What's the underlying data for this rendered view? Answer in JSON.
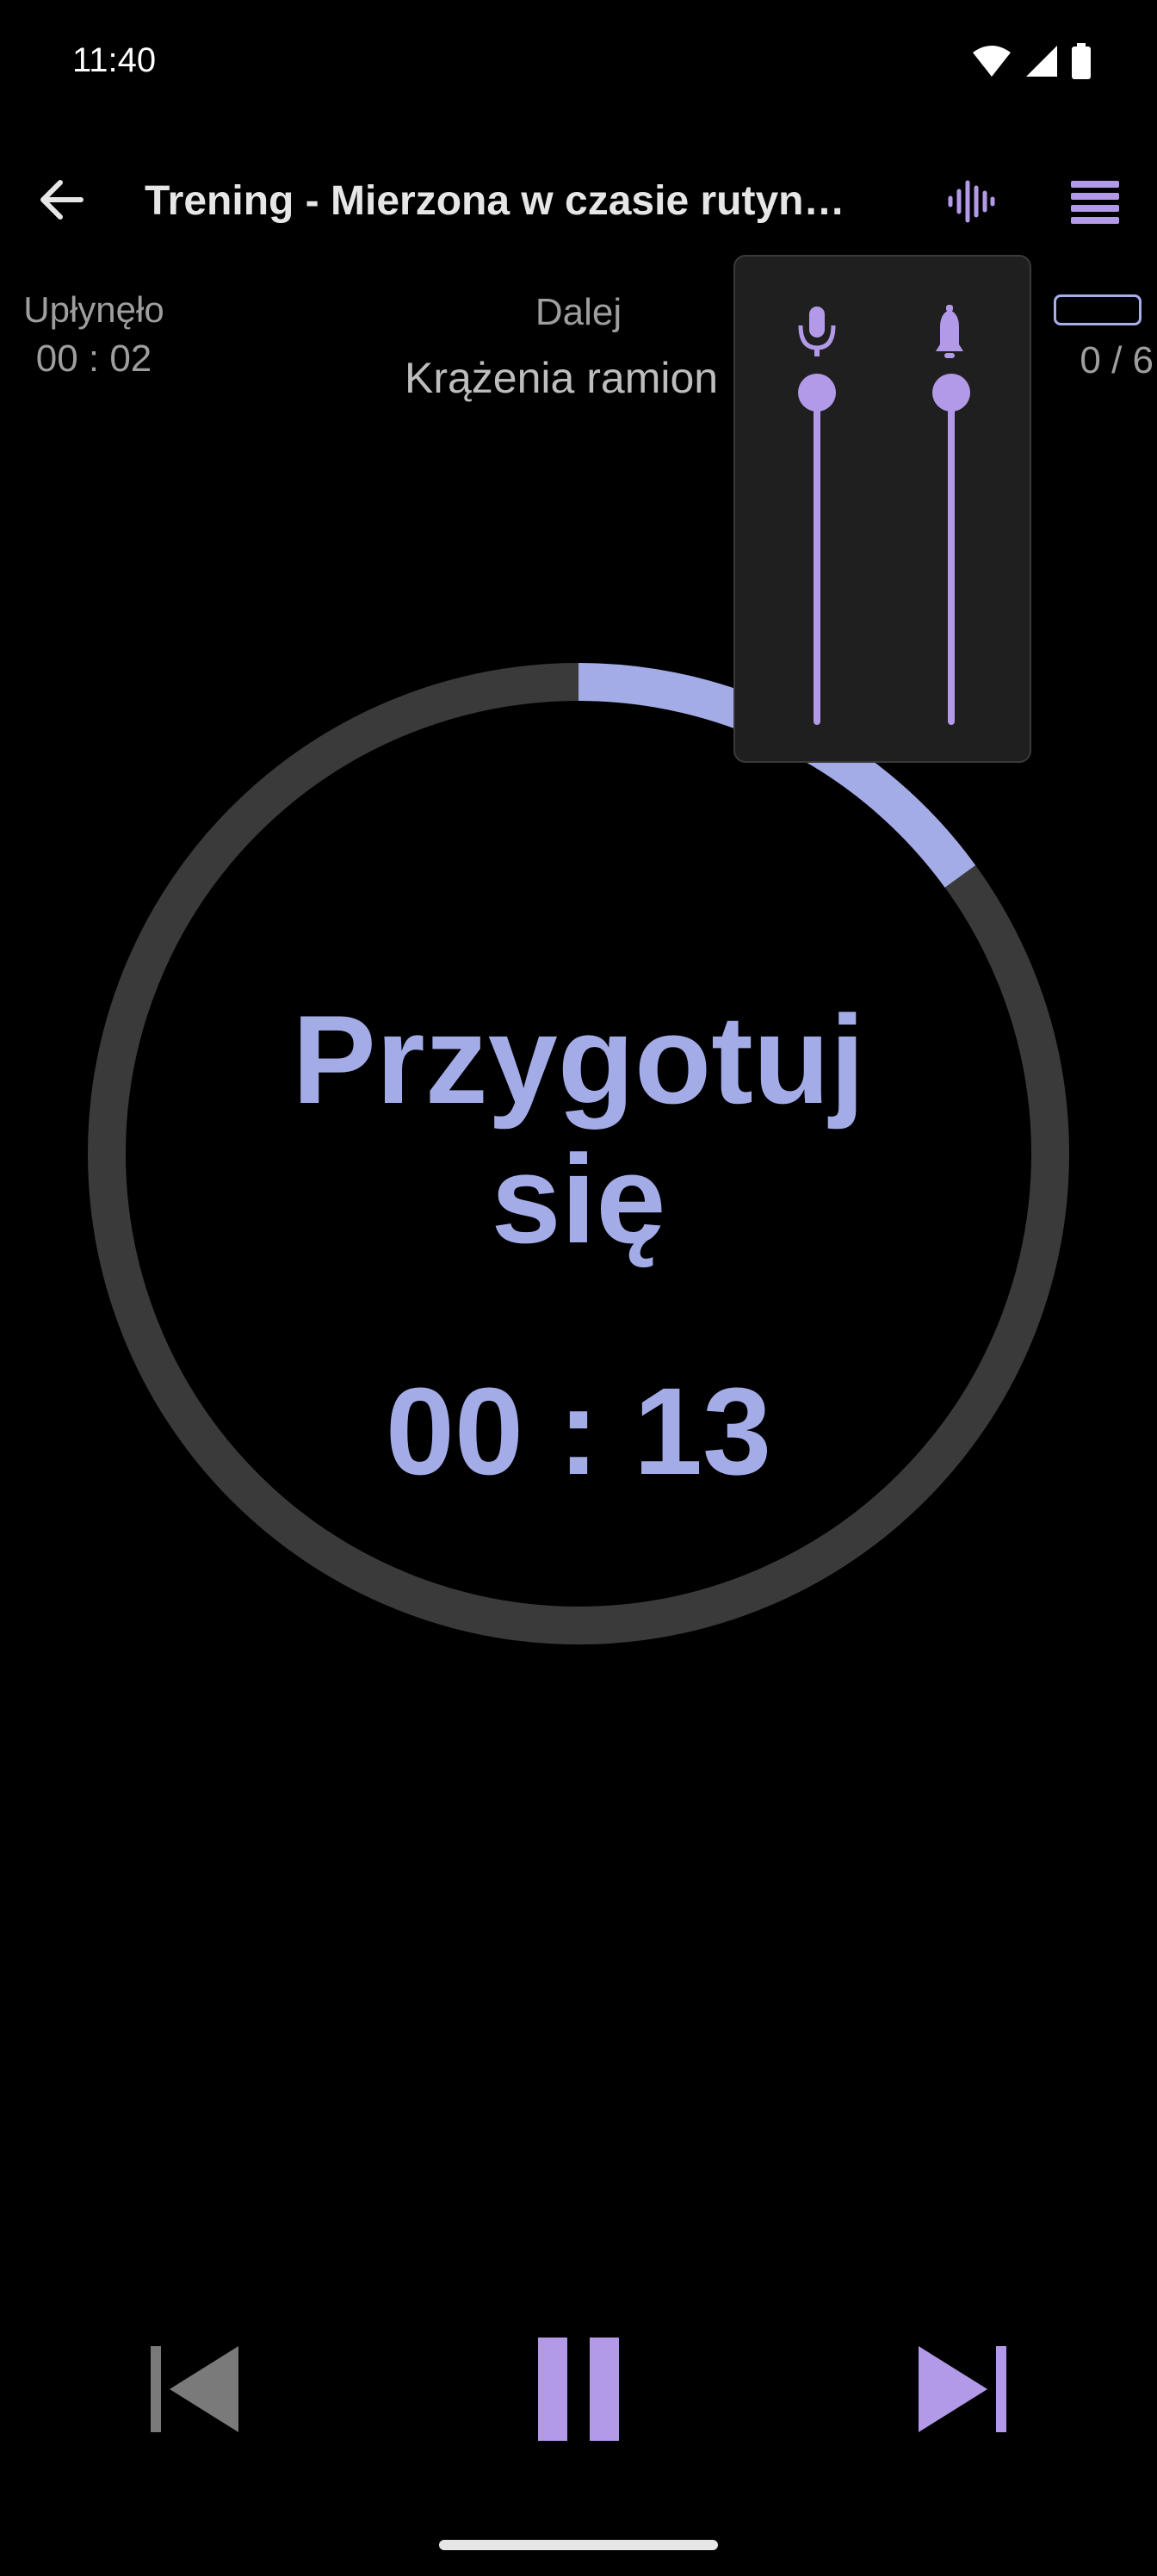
{
  "status_bar": {
    "time": "11:40",
    "icons": [
      "wifi-icon",
      "signal-icon",
      "battery-icon"
    ]
  },
  "app_bar": {
    "title": "Trening - Mierzona w czasie rutyn…",
    "back_icon": "arrow-left-icon",
    "voice_icon": "voice-waveform-icon",
    "menu_icon": "list-icon"
  },
  "info": {
    "elapsed_label": "Upłynęło",
    "elapsed_value": "00 : 02",
    "next_label": "Dalej",
    "next_value": "Krążenia ramion",
    "progress_count": "0 / 6",
    "progress_fraction": 0
  },
  "timer": {
    "phase": "Przygotuj się",
    "time_left": "00 : 13",
    "ring_progress": 0.15
  },
  "volume_popup": {
    "voice_icon": "microphone-icon",
    "beep_icon": "bell-icon",
    "voice_level": 1.0,
    "beep_level": 1.0
  },
  "controls": {
    "previous_icon": "skip-previous-icon",
    "pause_icon": "pause-icon",
    "next_icon": "skip-next-icon"
  },
  "colors": {
    "accent": "#a4ace8",
    "accent_purple": "#b39ae8",
    "ring_track": "#3a3a3a",
    "disabled": "#7a7a7a",
    "background": "#000000"
  }
}
